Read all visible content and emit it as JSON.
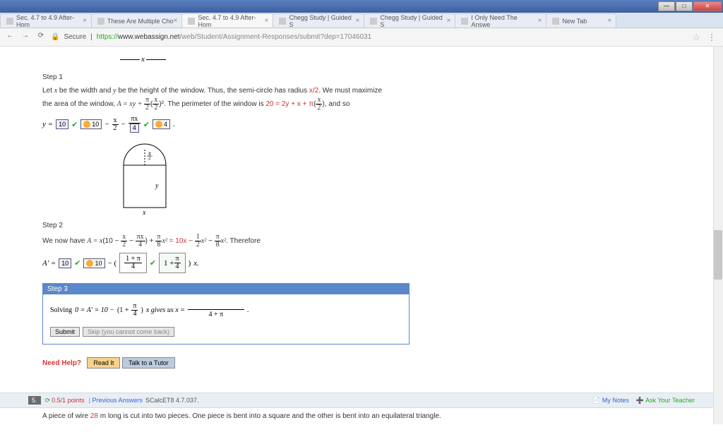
{
  "window": {
    "min": "—",
    "max": "□",
    "close": "✕",
    "glass": "Aero"
  },
  "tabs": [
    {
      "label": "Sec. 4.7 to 4.9 After-Hom"
    },
    {
      "label": "These Are Multiple Cho"
    },
    {
      "label": "Sec. 4.7 to 4.9 After-Hom",
      "active": true
    },
    {
      "label": "Chegg Study | Guided S"
    },
    {
      "label": "Chegg Study | Guided S"
    },
    {
      "label": "I Only Need The Answe"
    },
    {
      "label": "New Tab"
    }
  ],
  "addr": {
    "secure": "Secure",
    "proto": "https://",
    "host": "www.webassign.net",
    "path": "/web/Student/Assignment-Responses/submit?dep=17046031"
  },
  "dim_x": "x",
  "step1": {
    "label": "Step 1",
    "line1a": "Let ",
    "line1b": " be the width and ",
    "line1c": " be the height of the window. Thus, the semi-circle has radius ",
    "line1_var_x": "x",
    "line1_var_y": "y",
    "line1_radius": "x/2",
    "line1d": ". We must maximize",
    "line2a": "the area of the window, ",
    "line2_eq1": "A = xy + ",
    "line2b": ". The perimeter of the window is ",
    "line2_perim": "20 = 2y + x + π",
    "line2c": ", and so",
    "y_eq": "y =",
    "ans1": "10",
    "ans1b": "10",
    "minus": "−",
    "xov2_n": "x",
    "xov2_d": "2",
    "px_n": "πx",
    "ans2": "4",
    "ans3": "4",
    "dot": ".",
    "fig_xlabel": "x",
    "fig_ylabel": "y",
    "fig_top": "x/2"
  },
  "step2": {
    "label": "Step 2",
    "text_a": "We now have ",
    "eq1": "A = x",
    "open": "(",
    "num10": "10",
    "coeff_half_n": "1",
    "coeff_half_d": "2",
    "eq_mid": "= 10x − ",
    "pi8_n": "π",
    "pi8_d": "8",
    "x2": "x²",
    "therefore": ". Therefore",
    "aprime": "A' =",
    "ans1": "10",
    "ans1b": "10",
    "blank_eq": "1 + π",
    "blank_d": "4",
    "trail": "x.",
    "pxov4_n": "πx",
    "pxov4_d": "4"
  },
  "step3": {
    "hdr": "Step 3",
    "line_a": "Solving ",
    "eq": "0 = A' = 10 − ",
    "inner": "1 + π",
    "inner_d": "4",
    "gives": "x gives us  x =",
    "denom": "4 + π",
    "dot": ".",
    "submit": "Submit",
    "skip": "Skip (you cannot come back)"
  },
  "help": {
    "need": "Need Help?",
    "read": "Read It",
    "talk": "Talk to a Tutor"
  },
  "next": {
    "num": "5.",
    "pts": "0.5/1 points",
    "prev": "Previous Answers",
    "src": "SCalcET8 4.7.037.",
    "mynotes": "My Notes",
    "ask": "Ask Your Teacher",
    "text_a": "A piece of wire ",
    "len": "28",
    "text_b": " m long is cut into two pieces. One piece is bent into a square and the other is bent into an equilateral triangle."
  }
}
